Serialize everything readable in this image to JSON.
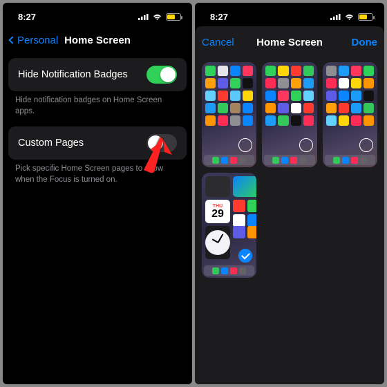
{
  "status": {
    "time": "8:27"
  },
  "left": {
    "back_label": "Personal",
    "title": "Home Screen",
    "row1_label": "Hide Notification Badges",
    "row1_footer": "Hide notification badges on Home Screen apps.",
    "row2_label": "Custom Pages",
    "row2_footer": "Pick specific Home Screen pages to show when the Focus is turned on."
  },
  "right": {
    "cancel": "Cancel",
    "title": "Home Screen",
    "done": "Done",
    "calendar": {
      "weekday": "THU",
      "day": "29"
    }
  },
  "app_colors_page1": [
    "#30d158",
    "#e5e5ea",
    "#0a84ff",
    "#ff375f",
    "#ff9f0a",
    "#5e5ce6",
    "#30d158",
    "#111",
    "#64d2ff",
    "#ff3b30",
    "#5ac8fa",
    "#ffd60a",
    "#1c9cf6",
    "#34c759",
    "#a2845e",
    "#0a84ff",
    "#ff9500",
    "#ff2d55",
    "#8e8e93",
    "#0a84ff"
  ],
  "app_colors_page2": [
    "#30d158",
    "#ffd60a",
    "#ff3b30",
    "#34c759",
    "#ff2d55",
    "#8e8e93",
    "#ff9f0a",
    "#1c9cf6",
    "#0a84ff",
    "#ff375f",
    "#30d158",
    "#64d2ff",
    "#ff9500",
    "#5e5ce6",
    "#ffffff",
    "#ff3b30",
    "#1c9cf6",
    "#34c759",
    "#111",
    "#ff2d55"
  ],
  "app_colors_page3": [
    "#8e8e93",
    "#1c9cf6",
    "#ff375f",
    "#30d158",
    "#ff2d55",
    "#ffffff",
    "#ffd60a",
    "#ff9500",
    "#5e5ce6",
    "#0a84ff",
    "#1c9cf6",
    "#111",
    "#ff9f0a",
    "#ff3b30",
    "#1c9cf6",
    "#34c759",
    "#64d2ff",
    "#ffd60a",
    "#ff2d55",
    "#ff9500"
  ],
  "dock_colors": [
    "#34c759",
    "#0a84ff",
    "#ff2d55",
    "#636366"
  ]
}
